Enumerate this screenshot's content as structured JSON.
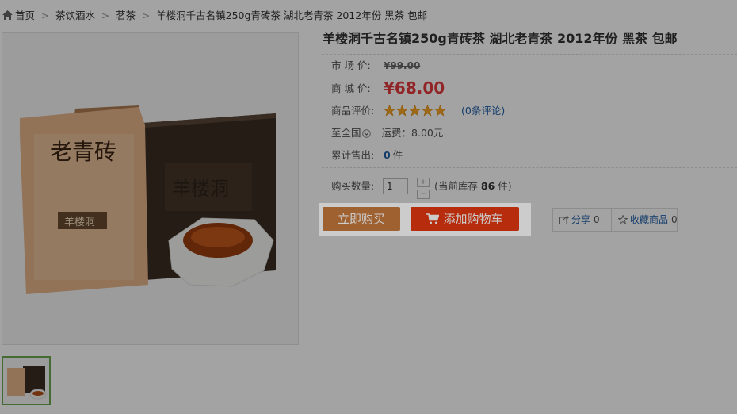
{
  "breadcrumb": {
    "home": "首页",
    "items": [
      "茶饮酒水",
      "茗茶",
      "羊楼洞千古名镇250g青砖茶 湖北老青茶 2012年份 黑茶 包邮"
    ]
  },
  "product": {
    "title": "羊楼洞千古名镇250g青砖茶 湖北老青茶 2012年份 黑茶 包邮",
    "market_price_label": "市 场 价:",
    "market_price": "¥99.00",
    "shop_price_label": "商 城 价:",
    "shop_price": "¥68.00",
    "rating_label": "商品评价:",
    "rating": 5,
    "rating_max": 5,
    "review_link": "(0条评论)",
    "shipping_region": "至全国",
    "shipping_fee": "运费：8.00元",
    "sold_label": "累计售出:",
    "sold_count": "0",
    "sold_unit": "件",
    "image_brand_text": "老青砖",
    "image_box_label": "羊楼洞"
  },
  "purchase": {
    "qty_label": "购买数量:",
    "qty_value": "1",
    "stepper_up": "+",
    "stepper_down": "−",
    "stock_prefix": "(当前库存",
    "stock_count": "86",
    "stock_suffix": "件)",
    "buy_now": "立即购买",
    "add_to_cart": "添加购物车"
  },
  "social": {
    "share_label": "分享",
    "share_count": "0",
    "favorite_label": "收藏商品",
    "favorite_count": "0"
  },
  "colors": {
    "buy_now_bg": "#c97a3c",
    "add_cart_bg": "#e4380f",
    "price_red": "#e4393c",
    "star_gold": "#f7a623",
    "link_blue": "#1f5fa8",
    "thumb_border": "#6aa84f"
  },
  "icons": [
    "home-icon",
    "star-icon",
    "dropdown-icon",
    "cart-icon",
    "share-icon",
    "star-outline-icon"
  ]
}
